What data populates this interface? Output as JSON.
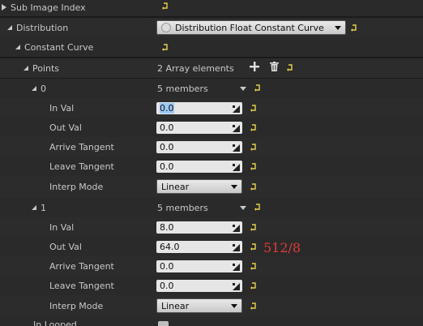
{
  "rows": {
    "sub_image_index": "Sub Image Index",
    "distribution": "Distribution",
    "distribution_value": "Distribution Float Constant Curve",
    "constant_curve": "Constant Curve",
    "points": "Points",
    "points_value": "2 Array elements",
    "p0_label": "0",
    "p0_members": "5 members",
    "p0_in_val_label": "In Val",
    "p0_in_val": "0.0",
    "p0_out_val_label": "Out Val",
    "p0_out_val": "0.0",
    "p0_arrive_label": "Arrive Tangent",
    "p0_arrive": "0.0",
    "p0_leave_label": "Leave Tangent",
    "p0_leave": "0.0",
    "p0_interp_label": "Interp Mode",
    "p0_interp": "Linear",
    "p1_label": "1",
    "p1_members": "5 members",
    "p1_in_val_label": "In Val",
    "p1_in_val": "8.0",
    "p1_out_val_label": "Out Val",
    "p1_out_val": "64.0",
    "p1_arrive_label": "Arrive Tangent",
    "p1_arrive": "0.0",
    "p1_leave_label": "Leave Tangent",
    "p1_leave": "0.0",
    "p1_interp_label": "Interp Mode",
    "p1_interp": "Linear",
    "bottom_label": "In Looped"
  },
  "annotation": "512/8",
  "colors": {
    "annotation": "#e03a3a",
    "reset_icon": "#e8d24a",
    "selection": "#9cc8f4"
  },
  "icons": {
    "add": "plus-icon",
    "delete": "trash-icon",
    "reset": "reset-to-default-icon",
    "expand": "triangle-icon"
  }
}
